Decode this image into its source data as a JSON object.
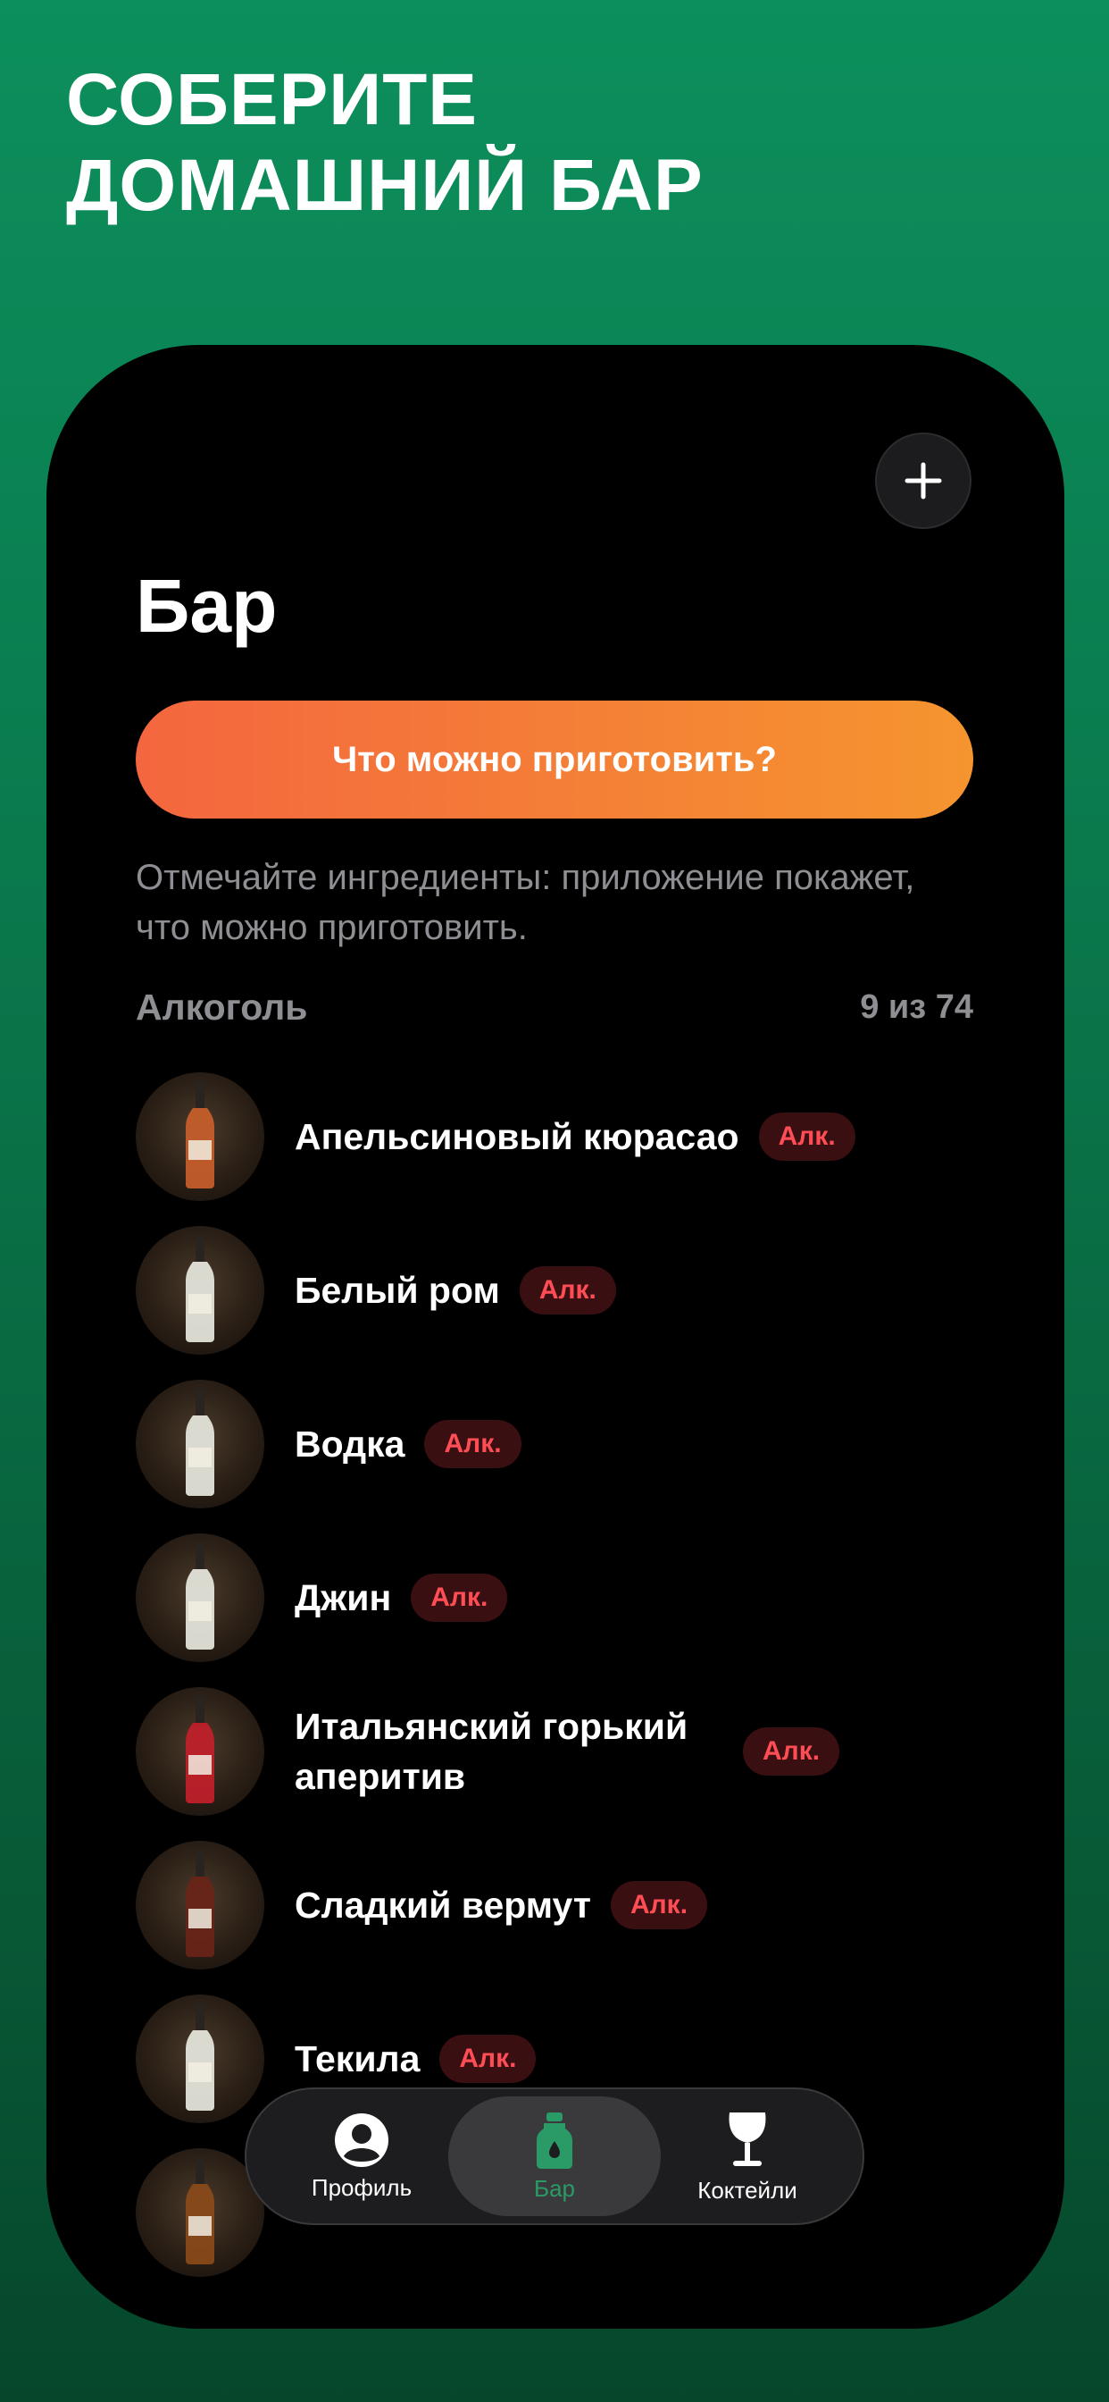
{
  "headline": {
    "line1": "СОБЕРИТЕ",
    "line2": "ДОМАШНИЙ БАР"
  },
  "screen": {
    "title": "Бар",
    "cta_label": "Что можно приготовить?",
    "hint": "Отмечайте ингредиенты: приложение покажет, что можно приготовить.",
    "section": {
      "title": "Алкоголь",
      "count": "9 из 74"
    },
    "items": [
      {
        "name": "Апельсиновый кюрасао",
        "badge": "Алк.",
        "liquid": "#c8602a"
      },
      {
        "name": "Белый ром",
        "badge": "Алк.",
        "liquid": "#e8e8e0"
      },
      {
        "name": "Водка",
        "badge": "Алк.",
        "liquid": "#e8e8e0"
      },
      {
        "name": "Джин",
        "badge": "Алк.",
        "liquid": "#e8e8e0"
      },
      {
        "name": "Итальянский горький аперитив",
        "badge": "Алк.",
        "liquid": "#c21f2a"
      },
      {
        "name": "Сладкий вермут",
        "badge": "Алк.",
        "liquid": "#6a2418"
      },
      {
        "name": "Текила",
        "badge": "Алк.",
        "liquid": "#e8e8e0"
      },
      {
        "name": "",
        "badge": "",
        "liquid": "#8a4a1a"
      }
    ]
  },
  "tabbar": {
    "tabs": [
      {
        "label": "Профиль",
        "icon": "profile-icon",
        "active": false
      },
      {
        "label": "Бар",
        "icon": "bottle-icon",
        "active": true
      },
      {
        "label": "Коктейли",
        "icon": "wine-glass-icon",
        "active": false
      }
    ]
  },
  "colors": {
    "accent_green": "#2a9a67",
    "cta_start": "#f4663f",
    "cta_end": "#f5952f",
    "badge_text": "#ff4d55",
    "badge_bg": "#3a0f12"
  }
}
